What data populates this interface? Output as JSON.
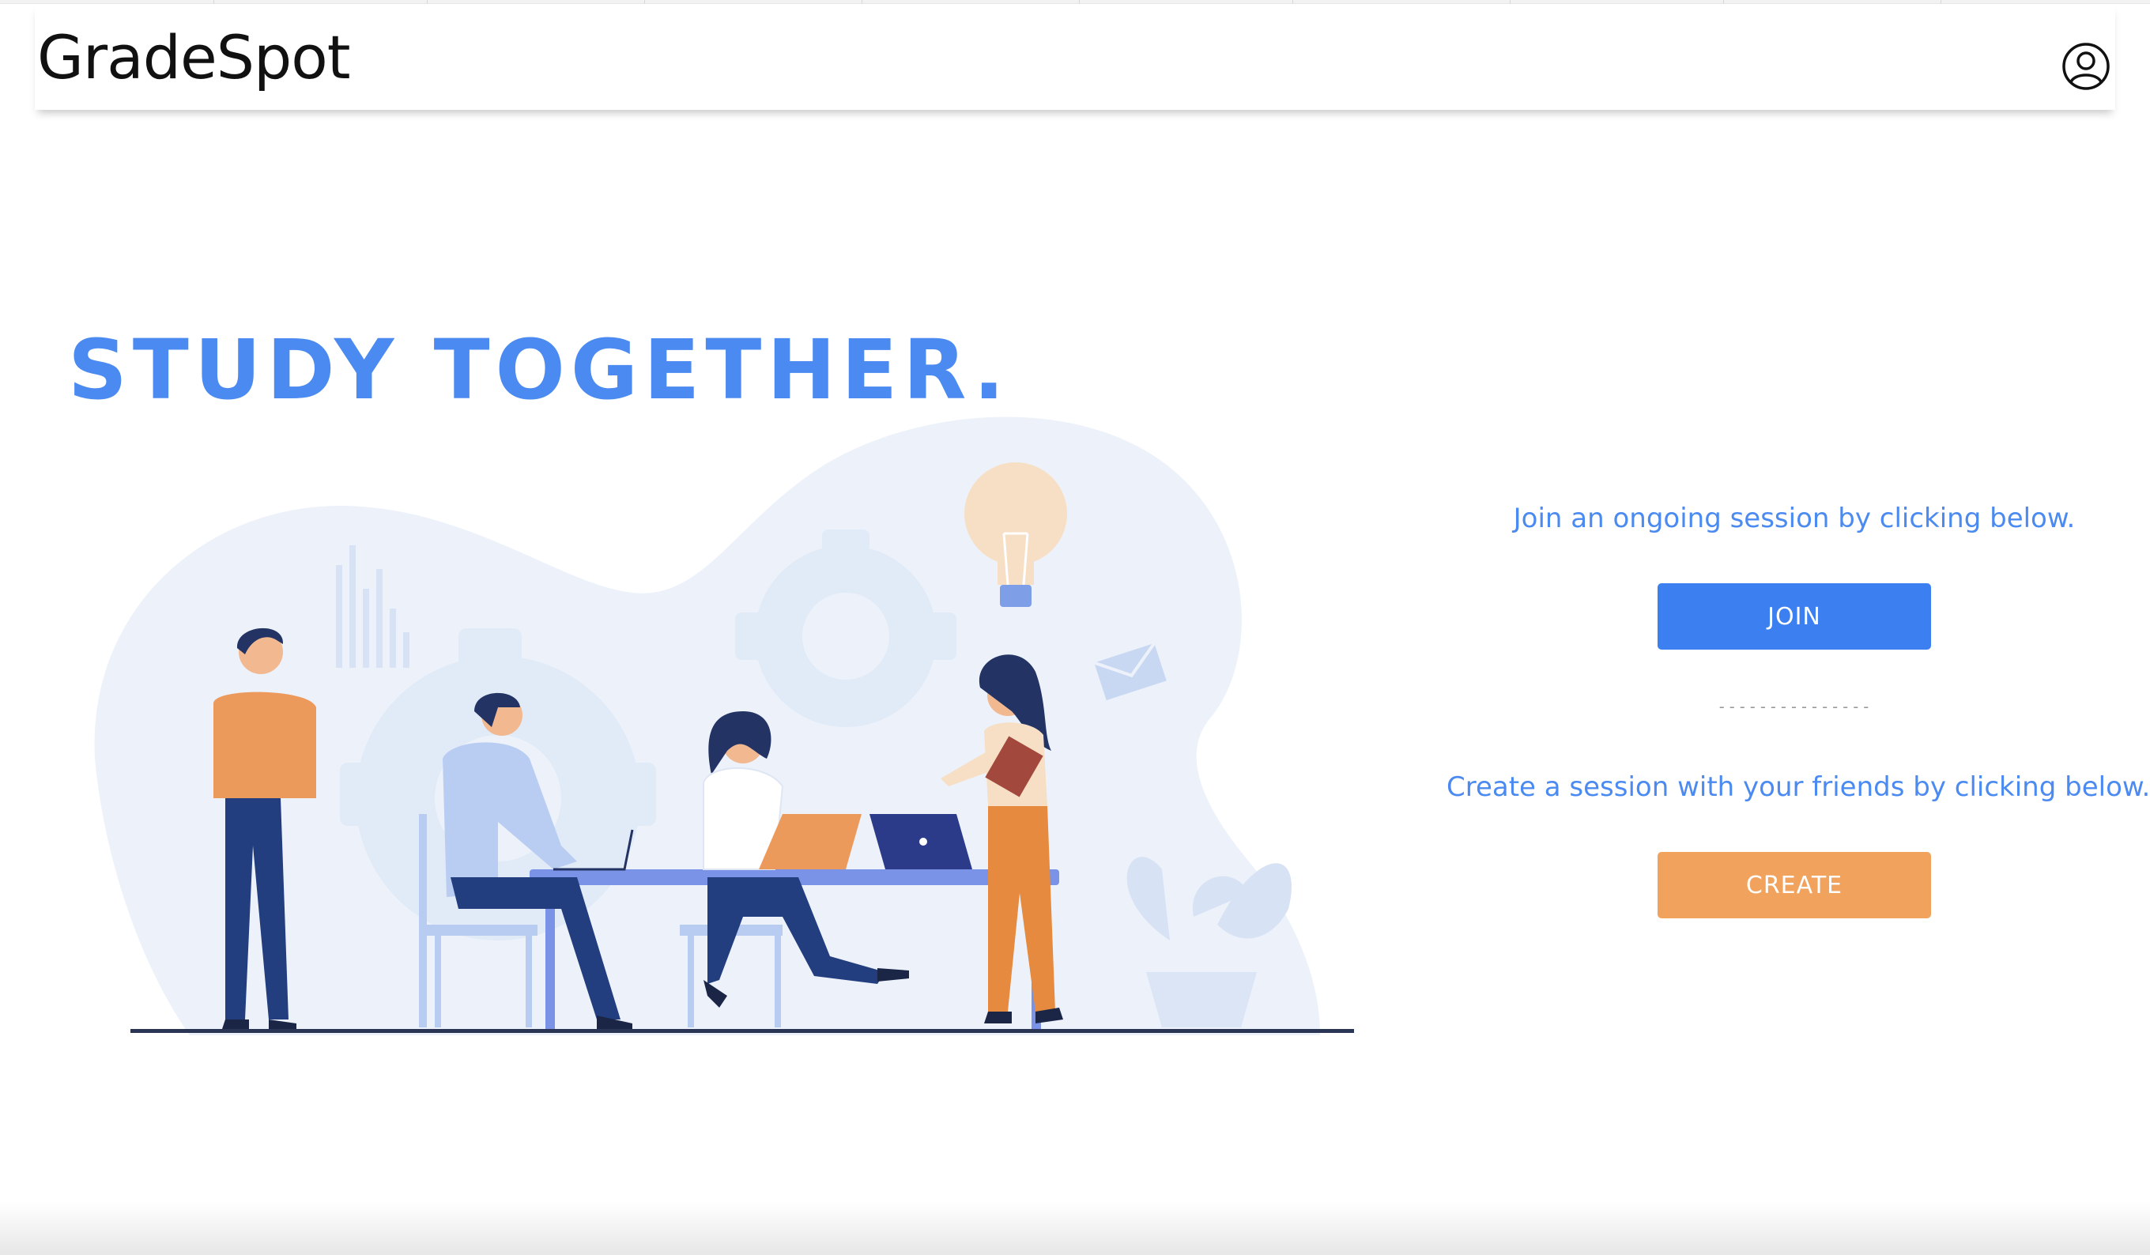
{
  "app": {
    "brand": "GradeSpot"
  },
  "header": {
    "profile_icon": "user-circle-icon"
  },
  "hero": {
    "title": "STUDY TOGETHER."
  },
  "join": {
    "prompt": "Join an ongoing session by clicking below.",
    "button_label": "JOIN"
  },
  "divider": {
    "text": "---------------"
  },
  "create": {
    "prompt": "Create a session with your friends by clicking below.",
    "button_label": "CREATE"
  },
  "colors": {
    "accent_blue": "#3b7ff1",
    "title_blue": "#4b8af0",
    "accent_orange": "#f1a25c"
  }
}
